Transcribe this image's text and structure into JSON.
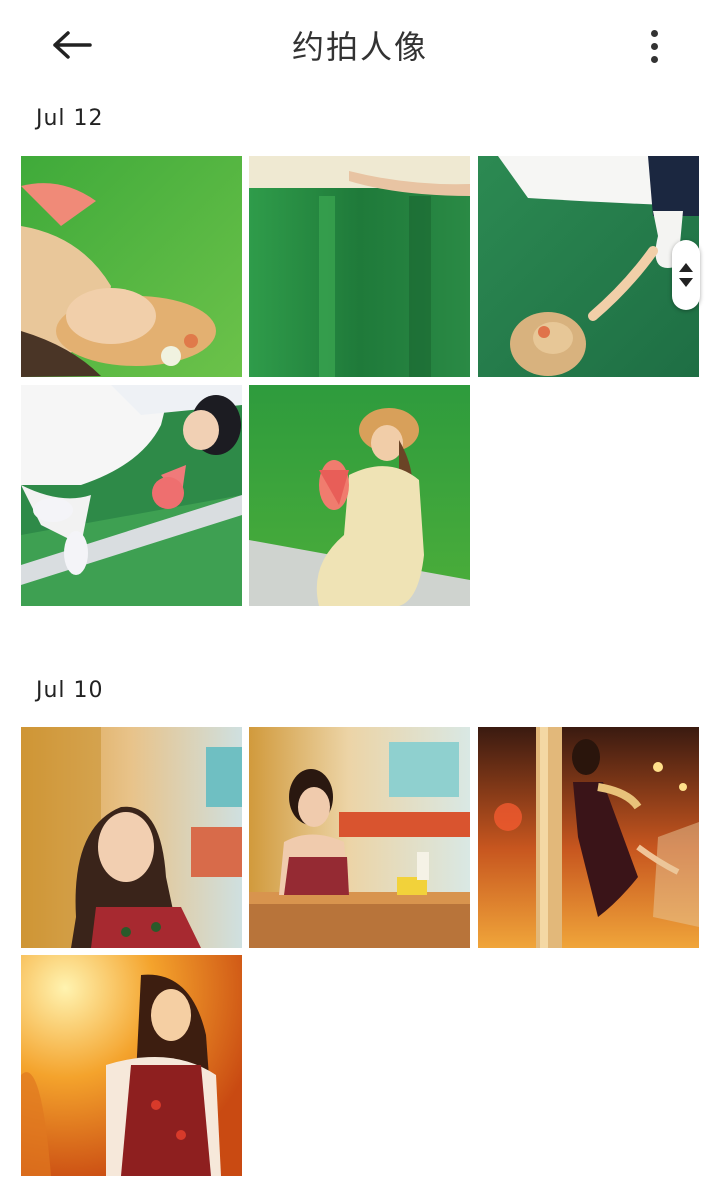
{
  "header": {
    "title": "约拍人像",
    "back_icon": "arrow-left-icon",
    "menu_icon": "more-vertical-icon"
  },
  "sections": [
    {
      "label": "Jul 12",
      "photo_count": 5
    },
    {
      "label": "Jul 10",
      "photo_count": 4
    }
  ],
  "colors": {
    "background": "#ffffff",
    "text": "#222222"
  }
}
